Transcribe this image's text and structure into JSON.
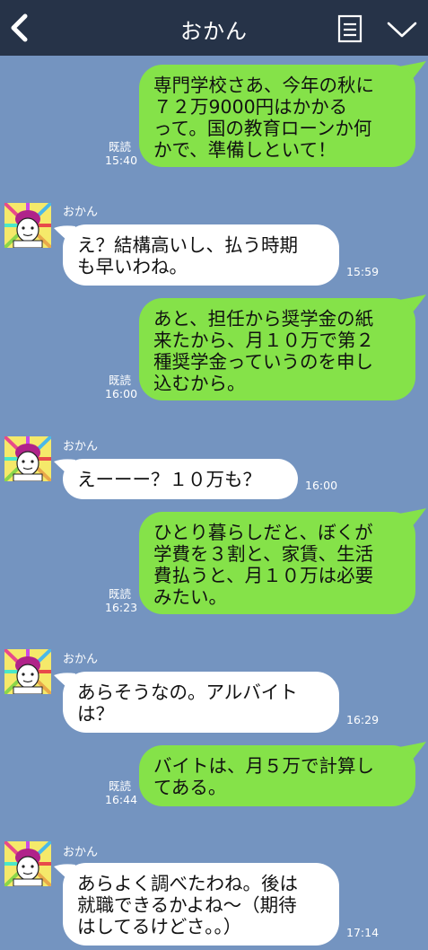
{
  "header": {
    "title": "おかん",
    "back_icon": "chevron-left-icon",
    "menu_icon": "list-icon",
    "collapse_icon": "chevron-down-icon"
  },
  "messages": [
    {
      "from": "me",
      "text": "専門学校さあ、今年の秋に\n７２万9000円はかかる\nって。国の教育ローンか何\nかで、準備しといて！",
      "read": "既読",
      "time": "15:40"
    },
    {
      "from": "mom",
      "sender": "おかん",
      "text": "え？結構高いし、払う時期\nも早いわね。",
      "time": "15:59"
    },
    {
      "from": "me",
      "text": "あと、担任から奨学金の紙\n来たから、月１０万で第２\n種奨学金っていうのを申し\n込むから。",
      "read": "既読",
      "time": "16:00"
    },
    {
      "from": "mom",
      "sender": "おかん",
      "text": "えーーー？１０万も？",
      "time": "16:00"
    },
    {
      "from": "me",
      "text": "ひとり暮らしだと、ぼくが\n学費を３割と、家賃、生活\n費払うと、月１０万は必要\nみたい。",
      "read": "既読",
      "time": "16:23"
    },
    {
      "from": "mom",
      "sender": "おかん",
      "text": "あらそうなの。アルバイト\nは？",
      "time": "16:29"
    },
    {
      "from": "me",
      "text": "バイトは、月５万で計算し\nてある。",
      "read": "既読",
      "time": "16:44"
    },
    {
      "from": "mom",
      "sender": "おかん",
      "text": "あらよく調べたわね。後は\n就職できるかよね〜（期待\nはしてるけどさ。。）",
      "time": "17:14"
    }
  ]
}
